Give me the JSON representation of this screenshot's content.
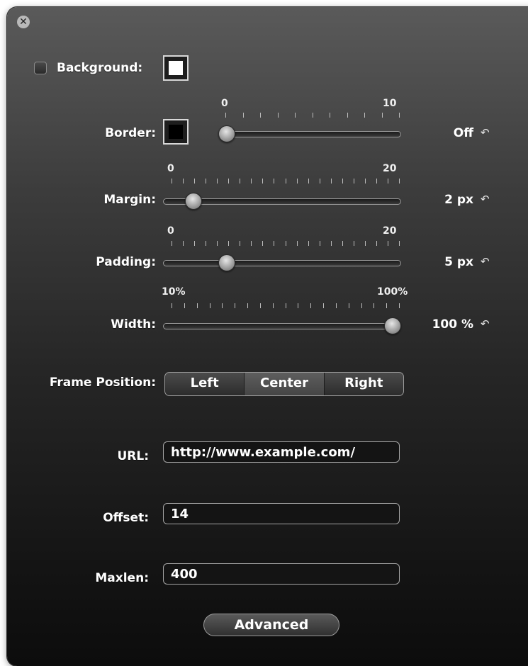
{
  "close_icon": "close-x-circle-icon",
  "background": {
    "label": "Background:",
    "checked": false,
    "swatch_color": "#ffffff"
  },
  "border": {
    "label": "Border:",
    "swatch_color": "#000000",
    "min": "0",
    "max": "10",
    "value": 0,
    "range": [
      0,
      10
    ],
    "value_text": "Off"
  },
  "margin": {
    "label": "Margin:",
    "min": "0",
    "max": "20",
    "value": 2,
    "range": [
      0,
      20
    ],
    "value_text": "2 px"
  },
  "padding": {
    "label": "Padding:",
    "min": "0",
    "max": "20",
    "value": 5,
    "range": [
      0,
      20
    ],
    "value_text": "5 px"
  },
  "width": {
    "label": "Width:",
    "min": "10%",
    "max": "100%",
    "value": 100,
    "range": [
      10,
      100
    ],
    "value_text": "100 %"
  },
  "reset_icon": "undo-arrow-icon",
  "frame_position": {
    "label": "Frame Position:",
    "options": [
      "Left",
      "Center",
      "Right"
    ],
    "selected": "Center"
  },
  "url": {
    "label": "URL:",
    "value": "http://www.example.com/"
  },
  "offset": {
    "label": "Offset:",
    "value": "14"
  },
  "maxlen": {
    "label": "Maxlen:",
    "value": "400"
  },
  "advanced_label": "Advanced"
}
